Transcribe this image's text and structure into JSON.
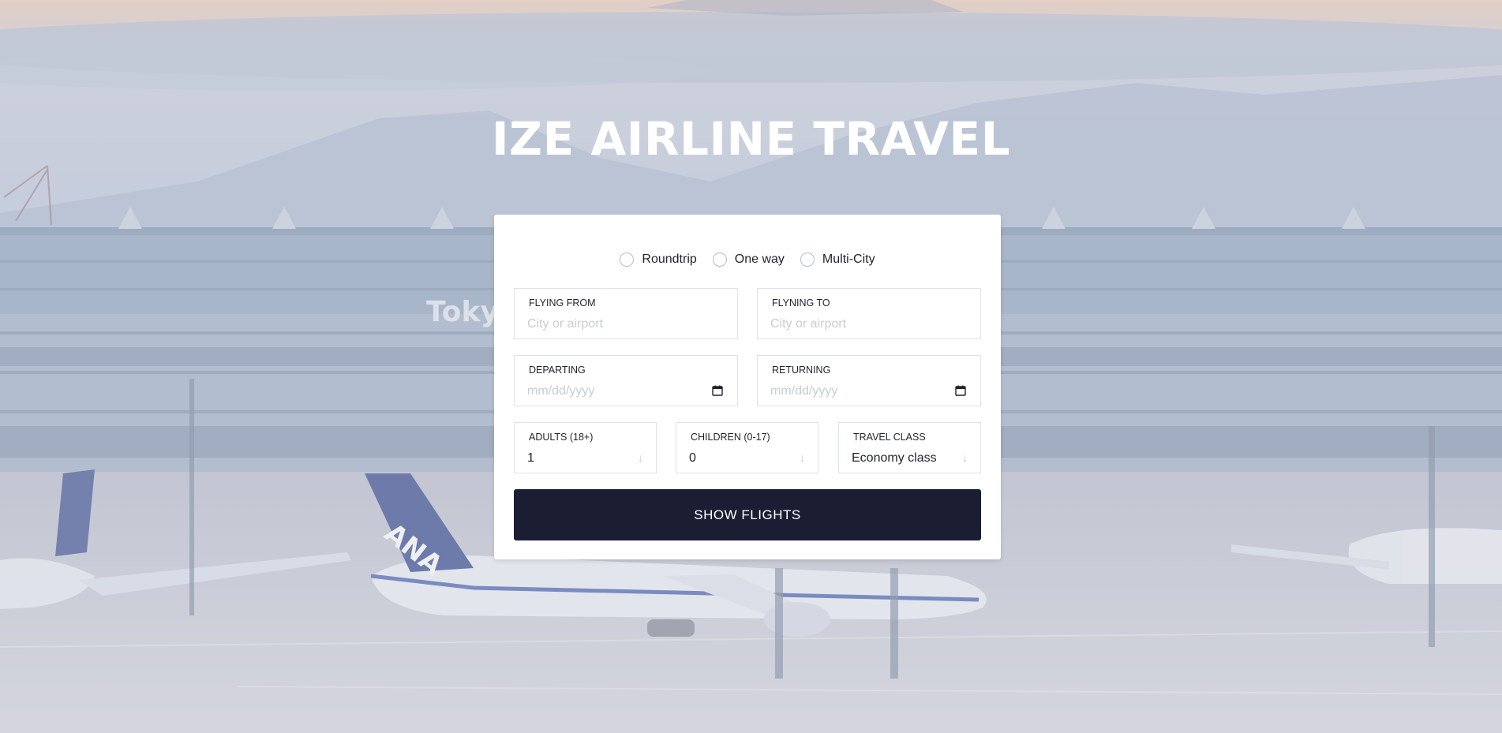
{
  "page": {
    "title": "IZE AIRLINE TRAVEL"
  },
  "background": {
    "terminal_sign": "Toky",
    "aircraft_livery": "ANA"
  },
  "form": {
    "trip_types": [
      {
        "label": "Roundtrip"
      },
      {
        "label": "One way"
      },
      {
        "label": "Multi-City"
      }
    ],
    "flying_from": {
      "label": "FLYING FROM",
      "placeholder": "City or airport"
    },
    "flying_to": {
      "label": "FLYNING TO",
      "placeholder": "City or airport"
    },
    "departing": {
      "label": "DEPARTING",
      "placeholder": "mm/dd/yyyy"
    },
    "returning": {
      "label": "RETURNING",
      "placeholder": "mm/dd/yyyy"
    },
    "adults": {
      "label": "ADULTS (18+)",
      "value": "1"
    },
    "children": {
      "label": "CHILDREN (0-17)",
      "value": "0"
    },
    "travel_class": {
      "label": "TRAVEL CLASS",
      "value": "Economy class"
    },
    "submit_label": "SHOW FLIGHTS"
  },
  "colors": {
    "button_bg": "#1b1e33",
    "title_text": "#ffffff",
    "placeholder_text": "#c8ccd5"
  }
}
